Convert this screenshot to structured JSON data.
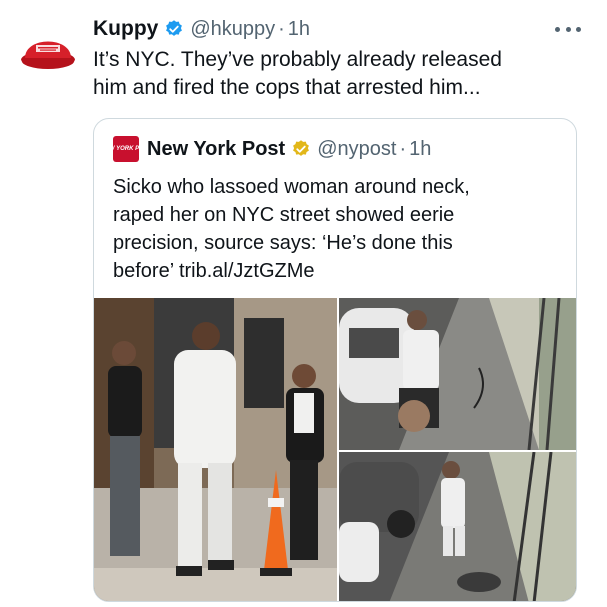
{
  "tweet": {
    "author_name": "Kuppy",
    "author_handle": "@hkuppy",
    "separator": "·",
    "timestamp": "1h",
    "text_line1": "It’s NYC. They’ve probably already released",
    "text_line2": "him and fired the cops that arrested him...",
    "avatar_icon": "red-cap-avatar",
    "verified_icon": "blue-verified-badge",
    "more_icon": "more-options-icon"
  },
  "quoted_tweet": {
    "author_name": "New York Post",
    "author_handle": "@nypost",
    "separator": "·",
    "timestamp": "1h",
    "logo_text": "NEW YORK POST",
    "verified_icon": "gold-verified-badge",
    "text_line1": "Sicko who lassoed woman around neck,",
    "text_line2": "raped her on NYC street showed eerie",
    "text_line3": "precision, source says: ‘He’s done this",
    "text_line4": "before’ trib.al/JztGZMe"
  },
  "colors": {
    "text_primary": "#0f1419",
    "text_secondary": "#536471",
    "verified_blue": "#1d9bf0",
    "verified_gold": "#e2b719",
    "nypost_red": "#c8102e",
    "border": "#cfd9de"
  }
}
